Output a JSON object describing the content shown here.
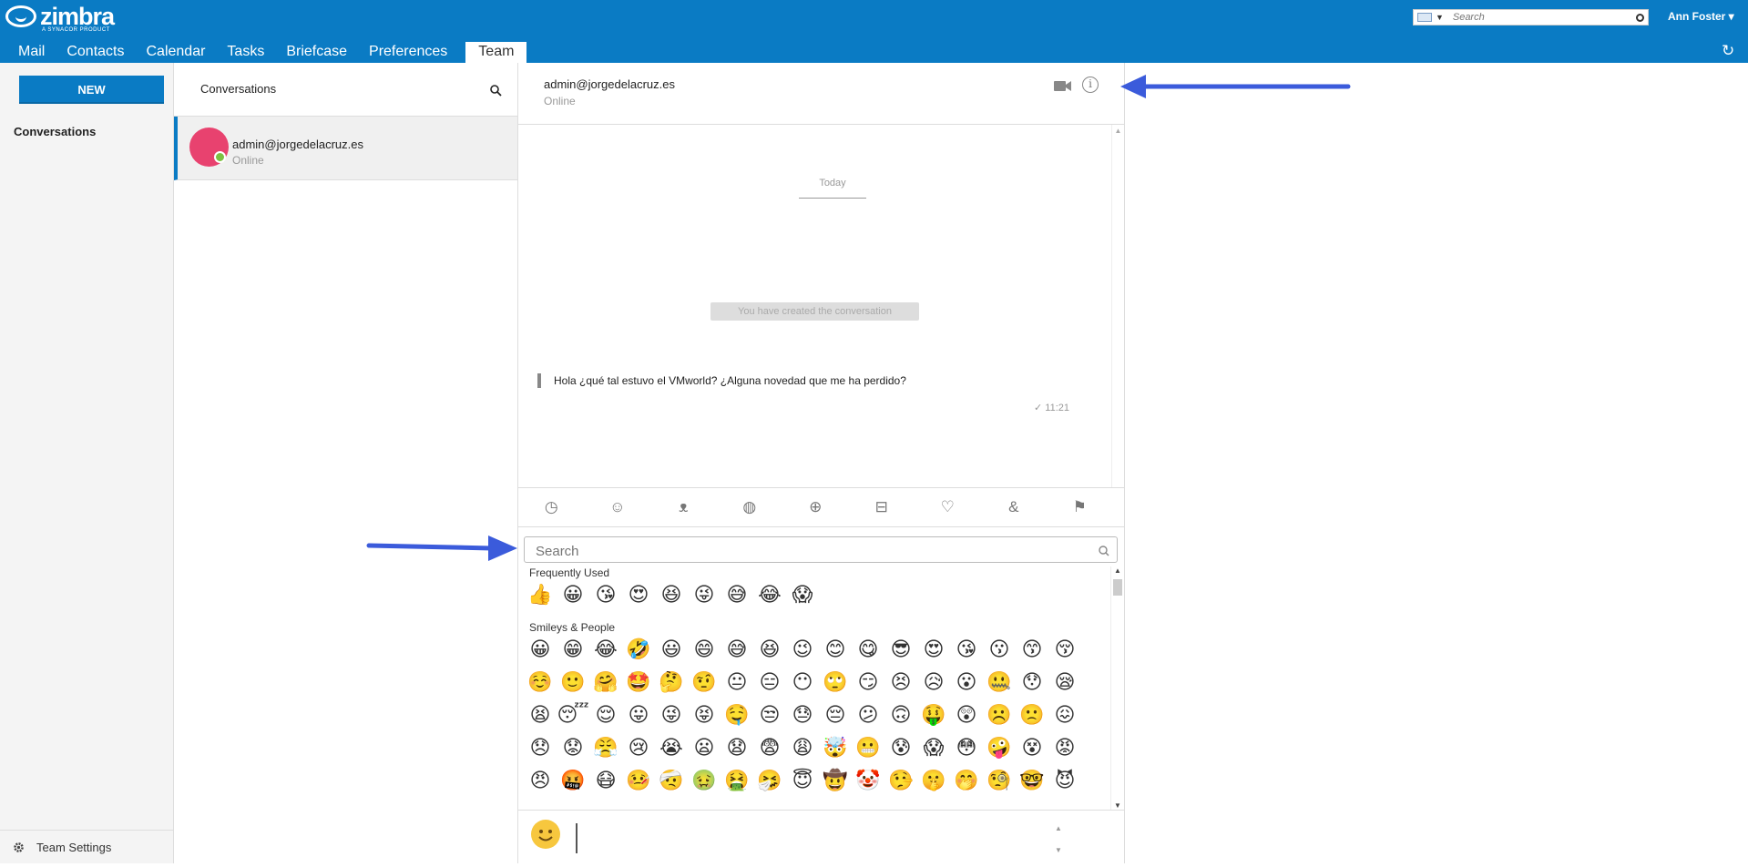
{
  "app": {
    "logo": "zimbra",
    "logo_sub": "A SYNACOR PRODUCT",
    "user": "Ann Foster",
    "search_placeholder": "Search"
  },
  "tabs": [
    "Mail",
    "Contacts",
    "Calendar",
    "Tasks",
    "Briefcase",
    "Preferences",
    "Team"
  ],
  "left": {
    "new_label": "NEW",
    "nav": "Conversations",
    "settings": "Team Settings"
  },
  "conversations": {
    "title": "Conversations",
    "items": [
      {
        "name": "admin@jorgedelacruz.es",
        "status": "Online",
        "avatar_color": "#e8426f",
        "status_color": "#7bc142"
      }
    ]
  },
  "chat": {
    "contact": "admin@jorgedelacruz.es",
    "status": "Online",
    "day": "Today",
    "system": "You have created the conversation",
    "message": "Hola ¿qué tal estuvo el VMworld? ¿Alguna novedad que me ha perdido?",
    "time": "11:21"
  },
  "emoji_picker": {
    "search_placeholder": "Search",
    "categories": [
      "recent-icon",
      "smiley-icon",
      "animal-icon",
      "food-icon",
      "sports-icon",
      "travel-icon",
      "objects-icon",
      "symbols-icon",
      "flags-icon"
    ],
    "frequent_label": "Frequently Used",
    "frequent": [
      "👍",
      "😀",
      "😘",
      "😍",
      "😆",
      "😜",
      "😅",
      "😂",
      "😱"
    ],
    "people_label": "Smileys & People",
    "people": [
      [
        "😀",
        "😁",
        "😂",
        "🤣",
        "😃",
        "😄",
        "😅",
        "😆",
        "😉",
        "😊",
        "😋",
        "😎",
        "😍",
        "😘",
        "😗",
        "😙",
        "😚"
      ],
      [
        "☺️",
        "🙂",
        "🤗",
        "🤩",
        "🤔",
        "🤨",
        "😐",
        "😑",
        "😶",
        "🙄",
        "😏",
        "😣",
        "😥",
        "😮",
        "🤐",
        "😯",
        "😪"
      ],
      [
        "😫",
        "😴",
        "😌",
        "😛",
        "😜",
        "😝",
        "🤤",
        "😒",
        "😓",
        "😔",
        "😕",
        "🙃",
        "🤑",
        "😲",
        "☹️",
        "🙁",
        "😖"
      ],
      [
        "😞",
        "😟",
        "😤",
        "😢",
        "😭",
        "😦",
        "😧",
        "😨",
        "😩",
        "🤯",
        "😬",
        "😰",
        "😱",
        "😳",
        "🤪",
        "😵",
        "😡"
      ],
      [
        "😠",
        "🤬",
        "😷",
        "🤒",
        "🤕",
        "🤢",
        "🤮",
        "🤧",
        "😇",
        "🤠",
        "🤡",
        "🤥",
        "🤫",
        "🤭",
        "🧐",
        "🤓",
        "😈"
      ]
    ]
  },
  "colors": {
    "brand": "#0a7bc4",
    "arrow": "#3b5bdb"
  }
}
